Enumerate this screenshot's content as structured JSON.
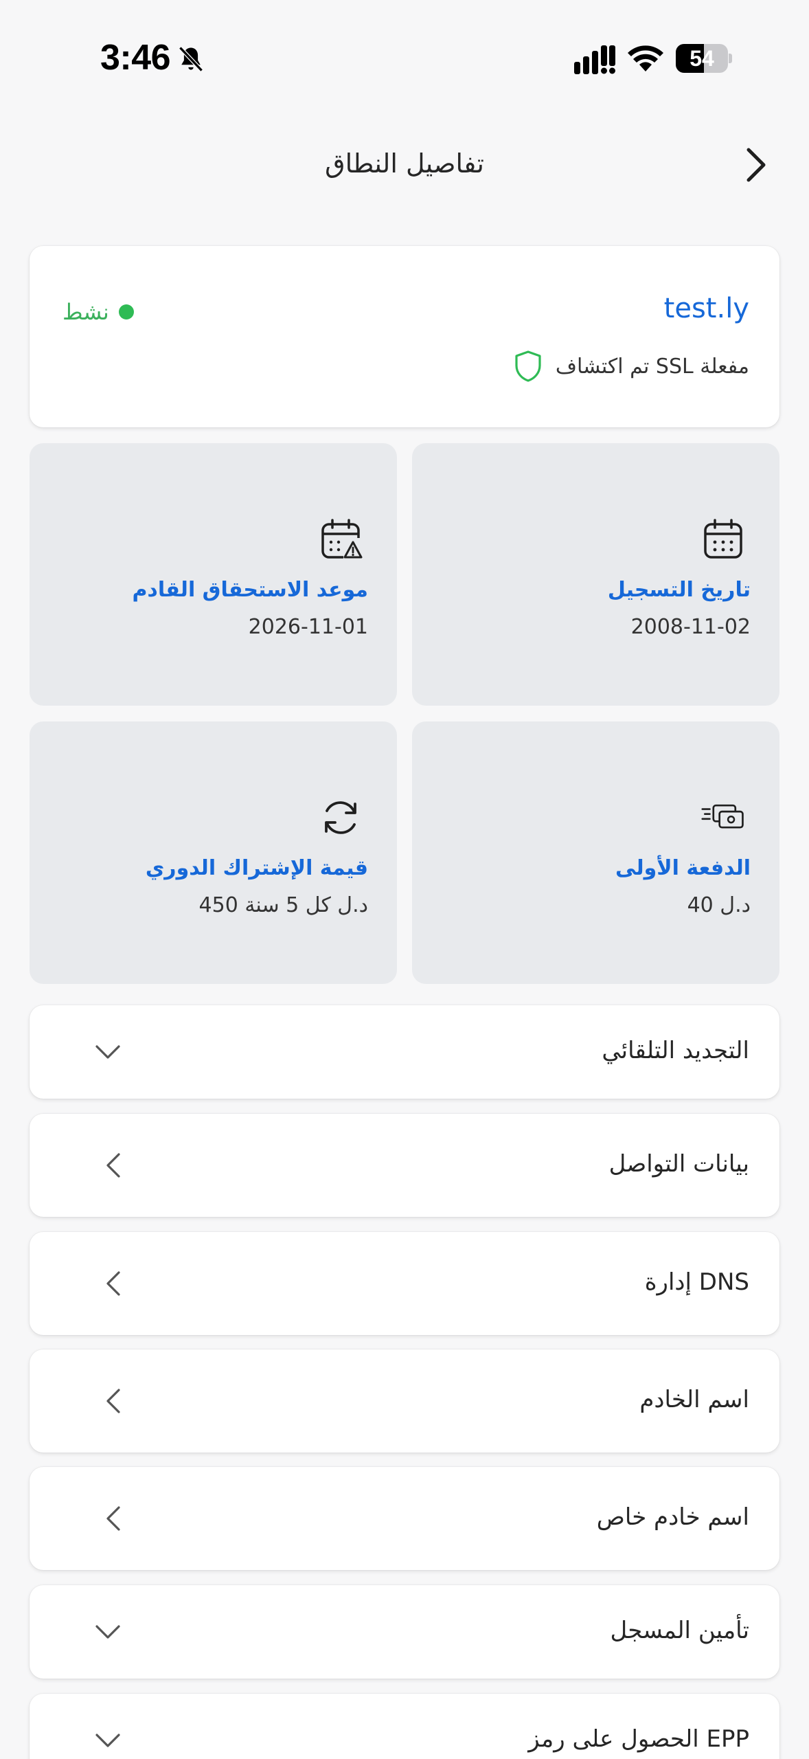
{
  "status_bar": {
    "time": "3:46",
    "battery_level": "54",
    "icons": [
      "bell-muted-icon",
      "signal-icon",
      "wifi-icon",
      "battery-icon"
    ]
  },
  "header": {
    "title": "تفاصيل النطاق",
    "back_icon": "chevron-right-icon"
  },
  "domain": {
    "name": "test.ly",
    "status": "نشط",
    "status_color": "#2fbb55",
    "ssl_text": "تم اكتشاف SSL مفعلة",
    "ssl_icon": "shield-icon"
  },
  "info_tiles": [
    {
      "icon": "calendar-icon",
      "label": "تاريخ التسجيل",
      "value": "2008-11-02"
    },
    {
      "icon": "calendar-warning-icon",
      "label": "موعد الاستحقاق القادم",
      "value": "2026-11-01"
    },
    {
      "icon": "money-icon",
      "label": "الدفعة الأولى",
      "value": "40 د.ل"
    },
    {
      "icon": "refresh-icon",
      "label": "قيمة الإشتراك الدوري",
      "value": "450 د.ل كل 5 سنة"
    }
  ],
  "sections": [
    {
      "label": "التجديد التلقائي",
      "icon": "chevron-down-icon"
    },
    {
      "label": "بيانات التواصل",
      "icon": "chevron-left-icon"
    },
    {
      "label": "إدارة DNS",
      "icon": "chevron-left-icon"
    },
    {
      "label": "اسم الخادم",
      "icon": "chevron-left-icon"
    },
    {
      "label": "اسم خادم خاص",
      "icon": "chevron-left-icon"
    },
    {
      "label": "تأمين المسجل",
      "icon": "chevron-down-icon"
    },
    {
      "label": "الحصول على رمز EPP",
      "icon": "chevron-down-icon"
    }
  ],
  "colors": {
    "accent": "#1668d8",
    "background": "#f7f7f8",
    "tile_background": "#e8eaed",
    "active_green": "#2fbb55"
  }
}
